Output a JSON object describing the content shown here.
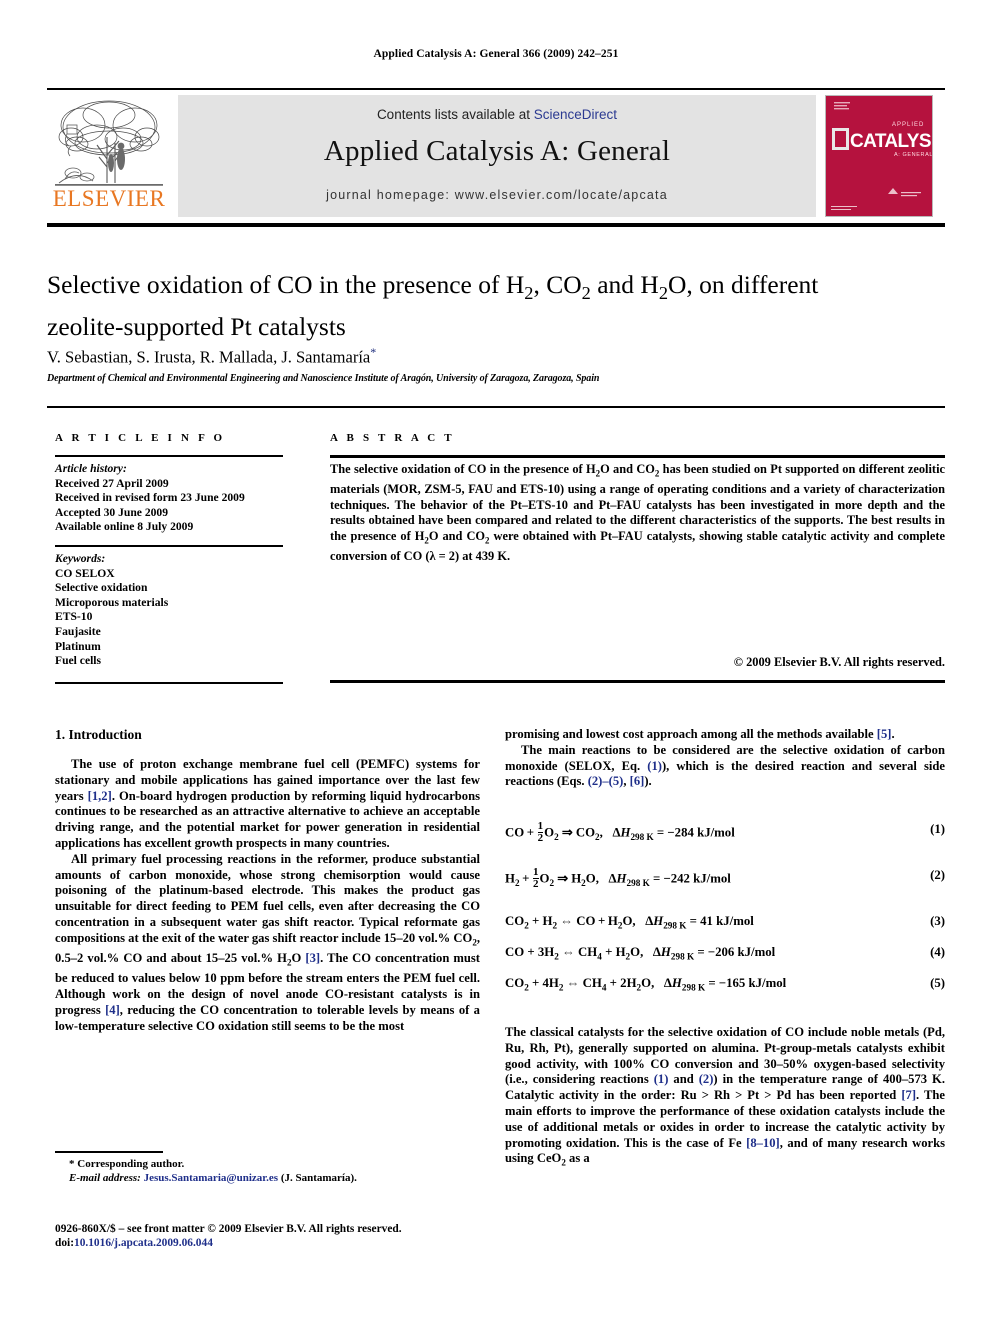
{
  "running_head": "Applied Catalysis A: General 366 (2009) 242–251",
  "journal_header": {
    "contents_prefix": "Contents lists available at ",
    "sciencedirect": "ScienceDirect",
    "journal_title": "Applied Catalysis A: General",
    "homepage": "journal homepage: www.elsevier.com/locate/apcata",
    "publisher_logo_text": "ELSEVIER",
    "cover_text_main": "CATALYSIS",
    "cover_text_small": "APPLIED",
    "cover_text_sub": "A: GENERAL",
    "band_color": "#e3e3e3",
    "link_color": "#2b3a91",
    "elsevier_orange": "#e87722",
    "cover_color": "#b5123e"
  },
  "article": {
    "title": "Selective oxidation of CO in the presence of H2, CO2 and H2O, on different zeolite-supported Pt catalysts",
    "authors": "V. Sebastian, S. Irusta, R. Mallada, J. Santamaría",
    "corresponding_marker": "*",
    "affiliation": "Department of Chemical and Environmental Engineering and Nanoscience Institute of Aragón, University of Zaragoza, Zaragoza, Spain"
  },
  "article_info": {
    "heading": "A R T I C L E   I N F O",
    "history_label": "Article history:",
    "history": [
      "Received 27 April 2009",
      "Received in revised form 23 June 2009",
      "Accepted 30 June 2009",
      "Available online 8 July 2009"
    ],
    "keywords_label": "Keywords:",
    "keywords": [
      "CO SELOX",
      "Selective oxidation",
      "Microporous materials",
      "ETS-10",
      "Faujasite",
      "Platinum",
      "Fuel cells"
    ]
  },
  "abstract": {
    "heading": "A B S T R A C T",
    "text": "The selective oxidation of CO in the presence of H2O and CO2 has been studied on Pt supported on different zeolitic materials (MOR, ZSM-5, FAU and ETS-10) using a range of operating conditions and a variety of characterization techniques. The behavior of the Pt–ETS-10 and Pt–FAU catalysts has been investigated in more depth and the results obtained have been compared and related to the different characteristics of the supports. The best results in the presence of H2O and CO2 were obtained with Pt–FAU catalysts, showing stable catalytic activity and complete conversion of CO (λ = 2) at 439 K.",
    "copyright": "© 2009 Elsevier B.V. All rights reserved."
  },
  "body": {
    "section_heading": "1. Introduction",
    "left_paragraphs": [
      "The use of proton exchange membrane fuel cell (PEMFC) systems for stationary and mobile applications has gained importance over the last few years [1,2]. On-board hydrogen production by reforming liquid hydrocarbons continues to be researched as an attractive alternative to achieve an acceptable driving range, and the potential market for power generation in residential applications has excellent growth prospects in many countries.",
      "All primary fuel processing reactions in the reformer, produce substantial amounts of carbon monoxide, whose strong chemisorption would cause poisoning of the platinum-based electrode. This makes the product gas unsuitable for direct feeding to PEM fuel cells, even after decreasing the CO concentration in a subsequent water gas shift reactor. Typical reformate gas compositions at the exit of the water gas shift reactor include 15–20 vol.% CO2, 0.5–2 vol.% CO and about 15–25 vol.% H2O [3]. The CO concentration must be reduced to values below 10 ppm before the stream enters the PEM fuel cell. Although work on the design of novel anode CO-resistant catalysts is in progress [4], reducing the CO concentration to tolerable levels by means of a low-temperature selective CO oxidation still seems to be the most"
    ],
    "right_paragraph_top_a": "promising and lowest cost approach among all the methods available [5].",
    "right_paragraph_top_b": "The main reactions to be considered are the selective oxidation of carbon monoxide (SELOX, Eq. (1)), which is the desired reaction and several side reactions (Eqs. (2)–(5), [6]).",
    "right_paragraph_bottom": "The classical catalysts for the selective oxidation of CO include noble metals (Pd, Ru, Rh, Pt), generally supported on alumina. Pt-group-metals catalysts exhibit good activity, with 100% CO conversion and 30–50% oxygen-based selectivity (i.e., considering reactions (1) and (2)) in the temperature range of 400–573 K. Catalytic activity in the order: Ru > Rh > Pt > Pd has been reported [7]. The main efforts to improve the performance of these oxidation catalysts include the use of additional metals or oxides in order to increase the catalytic activity by promoting oxidation. This is the case of Fe [8–10], and of many research works using CeO2 as a"
  },
  "equations": [
    {
      "number": "(1)",
      "lhs": "CO + ½ O2 ⇒ CO2,",
      "enthalpy": "ΔH298 K = −284 kJ/mol"
    },
    {
      "number": "(2)",
      "lhs": "H2 + ½ O2 ⇒ H2O,",
      "enthalpy": "ΔH298 K = −242 kJ/mol"
    },
    {
      "number": "(3)",
      "lhs": "CO2 + H2 ⇔ CO + H2O,",
      "enthalpy": "ΔH298 K = 41 kJ/mol"
    },
    {
      "number": "(4)",
      "lhs": "CO + 3H2 ⇔ CH4 + H2O,",
      "enthalpy": "ΔH298 K = −206 kJ/mol"
    },
    {
      "number": "(5)",
      "lhs": "CO2 + 4H2 ⇔ CH4 + 2H2O,",
      "enthalpy": "ΔH298 K = −165 kJ/mol"
    }
  ],
  "footnote": {
    "marker": "*",
    "corresponding": "Corresponding author.",
    "email_label": "E-mail address:",
    "email": "Jesus.Santamaria@unizar.es",
    "email_owner": "(J. Santamaría)."
  },
  "imprint": {
    "front_matter": "0926-860X/$ – see front matter © 2009 Elsevier B.V. All rights reserved.",
    "doi_label": "doi:",
    "doi": "10.1016/j.apcata.2009.06.044"
  }
}
